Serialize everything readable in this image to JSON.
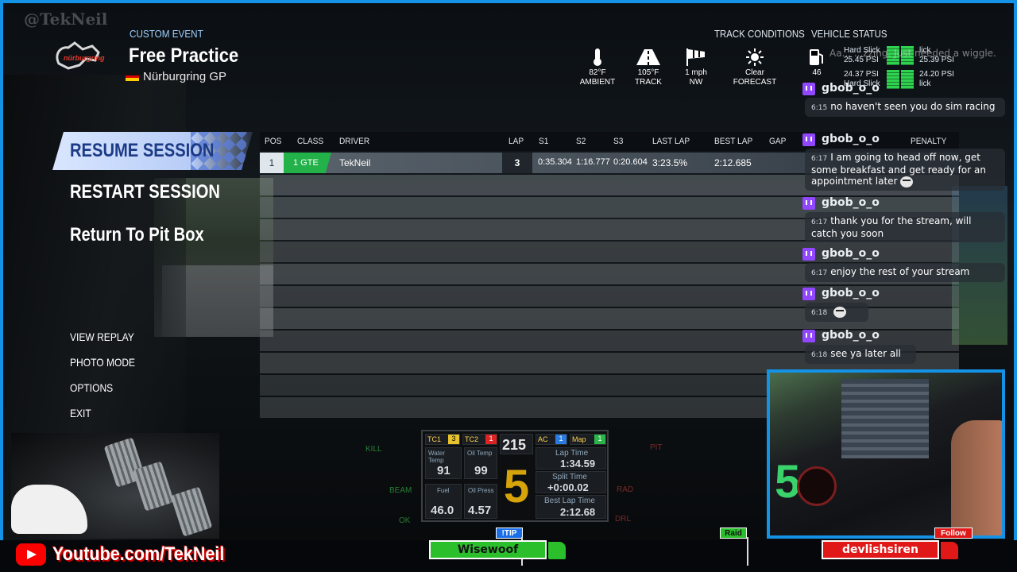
{
  "watermark": "@TekNeil",
  "header": {
    "event_type": "CUSTOM EVENT",
    "title": "Free Practice",
    "track": "Nürburgring GP",
    "logo_text": "nürburgring",
    "track_conditions_label": "TRACK CONDITIONS",
    "vehicle_status_label": "VEHICLE STATUS",
    "conditions": [
      {
        "icon": "thermometer-icon",
        "value": "82°F",
        "label": "AMBIENT"
      },
      {
        "icon": "road-icon",
        "value": "105°F",
        "label": "TRACK"
      },
      {
        "icon": "windsock-icon",
        "value": "1 mph",
        "label": "NW"
      },
      {
        "icon": "sun-icon",
        "value": "Clear",
        "label": "FORECAST"
      }
    ],
    "fuel": {
      "icon": "fuel-pump-icon",
      "value": "46"
    },
    "tires": {
      "fl_compound": "Hard Slick",
      "fl_psi": "25.45 PSI",
      "fr_compound": "lick",
      "fr_psi": "25.39 PSI",
      "rl_psi": "24.37 PSI",
      "rl_compound": "Hard Slick",
      "rr_psi": "24.20 PSI",
      "rr_compound": "lick"
    }
  },
  "menu": {
    "resume": "RESUME SESSION",
    "restart": "RESTART SESSION",
    "pitbox": "Return To Pit Box",
    "replay": "VIEW REPLAY",
    "photo": "PHOTO MODE",
    "options": "OPTIONS",
    "exit": "EXIT"
  },
  "table": {
    "headers": {
      "pos": "POS",
      "class": "CLASS",
      "driver": "DRIVER",
      "lap": "LAP",
      "s1": "S1",
      "s2": "S2",
      "s3": "S3",
      "last": "LAST LAP",
      "best": "BEST LAP",
      "gap": "GAP",
      "penalty": "PENALTY"
    },
    "rows": [
      {
        "pos": "1",
        "class": "1 GTE",
        "driver": "TekNeil",
        "lap": "3",
        "s1": "0:35.304",
        "s2": "1:16.777",
        "s3": "0:20.604",
        "last": "3:23.5%",
        "best": "2:12.685"
      }
    ]
  },
  "dash": {
    "tc1_label": "TC1",
    "tc1_val": "3",
    "tc2_label": "TC2",
    "tc2_val": "1",
    "speed": "215",
    "ac_label": "AC",
    "ac_val": "1",
    "map_label": "Map",
    "map_val": "1",
    "water_label": "Water Temp",
    "water_val": "91",
    "oil_label": "Oil Temp",
    "oil_val": "99",
    "laptime_label": "Lap Time",
    "laptime_val": "1:34.59",
    "gear": "5",
    "split_label": "Split Time",
    "split_val": "+0:00.02",
    "fuel_label": "Fuel",
    "fuel_val": "46.0",
    "oilp_label": "Oil Press",
    "oilp_val": "4.57",
    "best_label": "Best Lap Time",
    "best_val": "2:12.68",
    "kill": "KILL",
    "pit": "PIT",
    "beam": "BEAM",
    "rad": "RAD",
    "ok": "OK",
    "drl": "DRL"
  },
  "chat": {
    "overlap_text": "Aa... ...zzing. Just needed a wiggle.",
    "messages": [
      {
        "user": "gbob_o_o",
        "time": "6:15",
        "text": "no haven't seen you do sim racing",
        "emote": false
      },
      {
        "user": "gbob_o_o",
        "time": "6:17",
        "text": "I am going to head off now, get some breakfast and get ready for an appointment later",
        "emote": true
      },
      {
        "user": "gbob_o_o",
        "time": "6:17",
        "text": "thank you for the stream, will catch you soon",
        "emote": false
      },
      {
        "user": "gbob_o_o",
        "time": "6:17",
        "text": "enjoy the rest of your stream",
        "emote": false
      },
      {
        "user": "gbob_o_o",
        "time": "6:18",
        "text": "",
        "emote": true
      },
      {
        "user": "gbob_o_o",
        "time": "6:18",
        "text": "see ya later all",
        "emote": false
      }
    ]
  },
  "bottom": {
    "youtube": "Youtube.com/TekNeil",
    "tip_sign": "!TIP",
    "tip_name": "Wisewoof",
    "raid_sign": "Raid",
    "follow_sign": "Follow",
    "follow_name": "devlishsiren"
  },
  "colors": {
    "frame": "#1493e6",
    "class_green": "#23b14a",
    "twitch": "#9146ff",
    "youtube": "#ff0000",
    "gear": "#d7a30b"
  }
}
